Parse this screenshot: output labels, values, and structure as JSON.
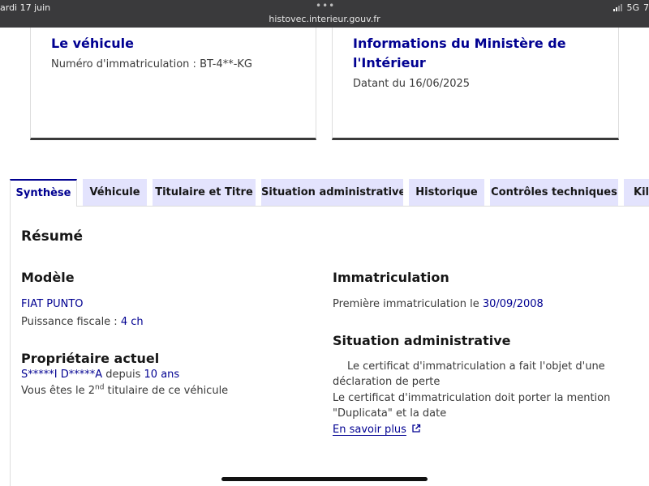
{
  "status_bar": {
    "date": "ardi 17 juin",
    "dots": "•••",
    "url": "histovec.interieur.gouv.fr",
    "network": "5G",
    "battery": "7"
  },
  "cards": {
    "vehicle": {
      "title": "Le véhicule",
      "plate_text": "Numéro d'immatriculation : BT-4**-KG"
    },
    "ministry": {
      "title": "Informations du Ministère de l'Intérieur",
      "date_text": "Datant du 16/06/2025"
    }
  },
  "tabs": [
    {
      "label": "Synthèse",
      "active": true
    },
    {
      "label": "Véhicule",
      "active": false
    },
    {
      "label": "Titulaire et Titre",
      "active": false
    },
    {
      "label": "Situation administrative",
      "active": false
    },
    {
      "label": "Historique",
      "active": false
    },
    {
      "label": "Contrôles techniques",
      "active": false
    },
    {
      "label": "Kil",
      "active": false
    }
  ],
  "summary": {
    "heading": "Résumé",
    "model": {
      "heading": "Modèle",
      "name": "FIAT PUNTO",
      "power_label": "Puissance fiscale : ",
      "power_value": "4 ch"
    },
    "owner": {
      "heading": "Propriétaire actuel",
      "name": "S*****I D*****A",
      "since_label": " depuis ",
      "since_value": "10 ans",
      "rank_prefix": "Vous êtes le 2",
      "rank_sup": "nd",
      "rank_suffix": " titulaire de ce véhicule"
    },
    "registration": {
      "heading": "Immatriculation",
      "first_label": "Première immatriculation le ",
      "first_date": "30/09/2008"
    },
    "admin": {
      "heading": "Situation administrative",
      "line1": "Le certificat d'immatriculation a fait l'objet d'une",
      "line2": "déclaration de perte",
      "line3": "Le certificat d'immatriculation doit porter la mention",
      "line4": "\"Duplicata\" et la date",
      "link": "En savoir plus"
    }
  },
  "colors": {
    "primary_blue": "#000091",
    "tab_bg": "#e3e3fd",
    "status_bar_bg": "#3a3a3c"
  }
}
